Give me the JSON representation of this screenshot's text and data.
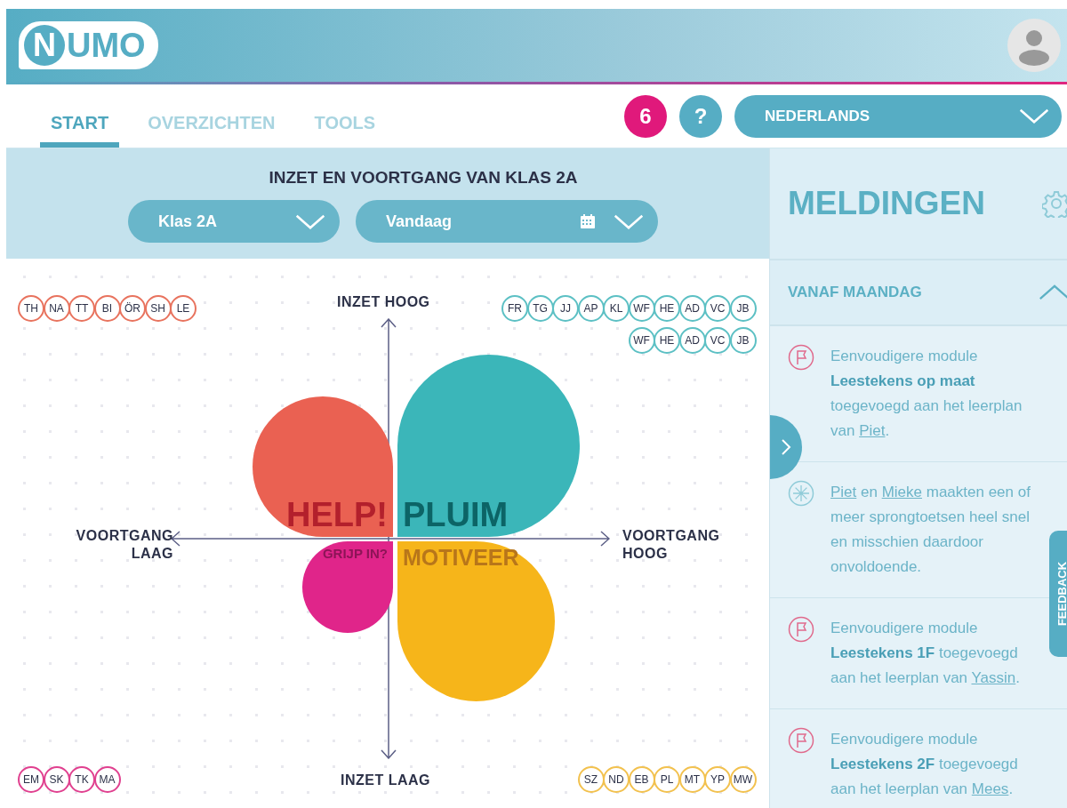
{
  "header": {
    "logo_mark": "N",
    "logo_text": "UMO"
  },
  "tabs": [
    {
      "label": "START",
      "selected": true
    },
    {
      "label": "OVERZICHTEN",
      "selected": false
    },
    {
      "label": "TOOLS",
      "selected": false
    }
  ],
  "notification_badge": "6",
  "help_button": "?",
  "language_select": "NEDERLANDS",
  "class_overview": {
    "title": "INZET EN VOORTGANG VAN KLAS 2A",
    "class_select": "Klas 2A",
    "date_select": "Vandaag"
  },
  "quadrant_chart": {
    "axis_labels": {
      "top": "INZET HOOG",
      "bottom": "INZET LAAG",
      "left": "VOORTGANG LAAG",
      "right": "VOORTGANG HOOG"
    },
    "quadrants": [
      {
        "kind": "help",
        "label": "HELP!",
        "color": "#ea6152"
      },
      {
        "kind": "pluim",
        "label": "PLUIM",
        "color": "#3bb6b9"
      },
      {
        "kind": "grijp",
        "label": "GRIJP IN?",
        "color": "#e0258a"
      },
      {
        "kind": "motiveer",
        "label": "MOTIVEER",
        "color": "#f6b51a"
      }
    ]
  },
  "student_groups": [
    {
      "kind": "top-left",
      "color": "#e8735e",
      "students": [
        "TH",
        "NA",
        "TT",
        "BI",
        "ÖR",
        "SH",
        "LE"
      ]
    },
    {
      "kind": "top-right",
      "color": "#5cc0c4",
      "students": [
        "FR",
        "TG",
        "JJ",
        "AP",
        "KL",
        "WF",
        "HE",
        "AD",
        "VC",
        "JB",
        "WF",
        "HE",
        "AD",
        "VC",
        "JB"
      ]
    },
    {
      "kind": "bottom-left",
      "color": "#e0408f",
      "students": [
        "EM",
        "SK",
        "TK",
        "MA"
      ]
    },
    {
      "kind": "bottom-right",
      "color": "#f2c14e",
      "students": [
        "SZ",
        "ND",
        "EB",
        "PL",
        "MT",
        "YP",
        "MW"
      ]
    }
  ],
  "notifications_panel": {
    "title": "MELDINGEN",
    "section": {
      "title": "VANAF MAANDAG",
      "expanded": true
    },
    "notifications": [
      {
        "kind": "module",
        "parts": [
          {
            "kind": "plain",
            "text": "Eenvoudigere module "
          },
          {
            "kind": "bold",
            "text": "Leestekens op maat"
          },
          {
            "kind": "plain",
            "text": " toegevoegd aan het leerplan van "
          },
          {
            "kind": "link",
            "text": "Piet"
          },
          {
            "kind": "plain",
            "text": "."
          }
        ]
      },
      {
        "kind": "speed",
        "parts": [
          {
            "kind": "link",
            "text": "Piet"
          },
          {
            "kind": "plain",
            "text": " en "
          },
          {
            "kind": "link",
            "text": "Mieke"
          },
          {
            "kind": "plain",
            "text": " maakten een of meer sprongtoetsen heel snel en misschien daardoor onvoldoende."
          }
        ]
      },
      {
        "kind": "module",
        "parts": [
          {
            "kind": "plain",
            "text": "Eenvoudigere module "
          },
          {
            "kind": "bold",
            "text": "Leestekens 1F"
          },
          {
            "kind": "plain",
            "text": " toegevoegd aan het leerplan van "
          },
          {
            "kind": "link",
            "text": "Yassin"
          },
          {
            "kind": "plain",
            "text": "."
          }
        ]
      },
      {
        "kind": "module",
        "parts": [
          {
            "kind": "plain",
            "text": "Eenvoudigere module "
          },
          {
            "kind": "bold",
            "text": "Leestekens 2F"
          },
          {
            "kind": "plain",
            "text": " toegevoegd aan het leerplan van "
          },
          {
            "kind": "link",
            "text": "Mees"
          },
          {
            "kind": "plain",
            "text": "."
          }
        ]
      }
    ]
  },
  "feedback_tab": "FEEDBACK"
}
